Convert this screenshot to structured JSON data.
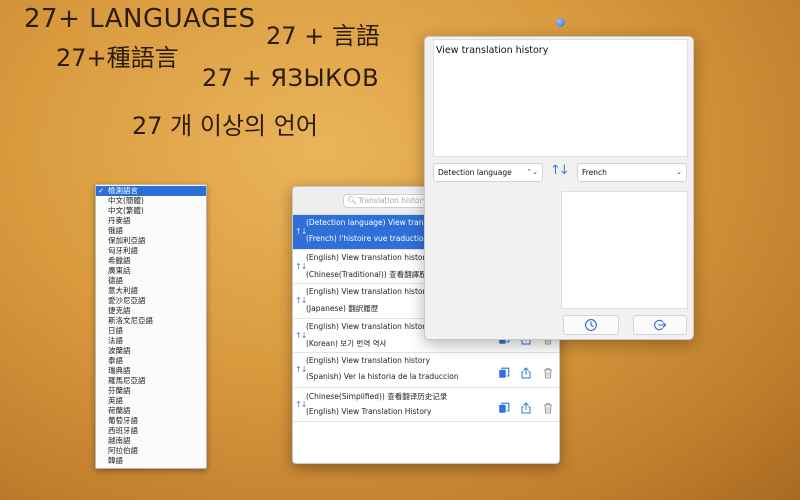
{
  "headlines": {
    "english": "27+ LANGUAGES",
    "chinese_traditional": "27+種語言",
    "japanese": "27 + 言語",
    "russian": "27 + ЯЗЫКОВ",
    "korean": "27 개 이상의 언어"
  },
  "language_dropdown": {
    "selected_check": "✓",
    "items": [
      "檢測語言",
      "中文(簡體)",
      "中文(繁體)",
      "丹麥語",
      "俄語",
      "保加利亞語",
      "匈牙利語",
      "希臘語",
      "廣東話",
      "德語",
      "意大利語",
      "愛沙尼亞語",
      "捷克語",
      "斯洛文尼亞語",
      "日語",
      "法語",
      "波蘭語",
      "泰語",
      "瑞典語",
      "羅馬尼亞語",
      "芬蘭語",
      "英語",
      "荷蘭語",
      "葡萄牙語",
      "西班牙語",
      "越南語",
      "阿拉伯語",
      "韓語"
    ]
  },
  "history_window": {
    "search_placeholder": "Translation history",
    "search_icon": "magnifier-icon",
    "rows": [
      {
        "source": "(Detection language) View translation history",
        "target": "(French) l'histoire vue traduction"
      },
      {
        "source": "(English) View translation history",
        "target": "(Chinese(Traditional)) 查看翻譯歷史記錄"
      },
      {
        "source": "(English) View translation history",
        "target": "(Japanese) 翻訳履歴"
      },
      {
        "source": "(English) View translation history",
        "target": "(Korean) 보기 번역 역사"
      },
      {
        "source": "(English) View translation history",
        "target": "(Spanish) Ver la historia de la traduccion"
      },
      {
        "source": "(Chinese(Simplified)) 查看翻译历史记录",
        "target": "(English) View Translation History"
      }
    ],
    "row_icons": [
      "swap-arrows-icon",
      "copy-icon",
      "share-icon",
      "trash-icon"
    ]
  },
  "main_window": {
    "input_text": "View translation history",
    "source_language": "Detection language",
    "target_language": "French",
    "swap_glyph": "↑↓",
    "source_arrow": "⌃⌄",
    "target_arrow": "⌄"
  },
  "colors": {
    "accent": "#2e6fd8",
    "background_gold": "#d99a3e",
    "icon_blue": "#3a83e6"
  }
}
